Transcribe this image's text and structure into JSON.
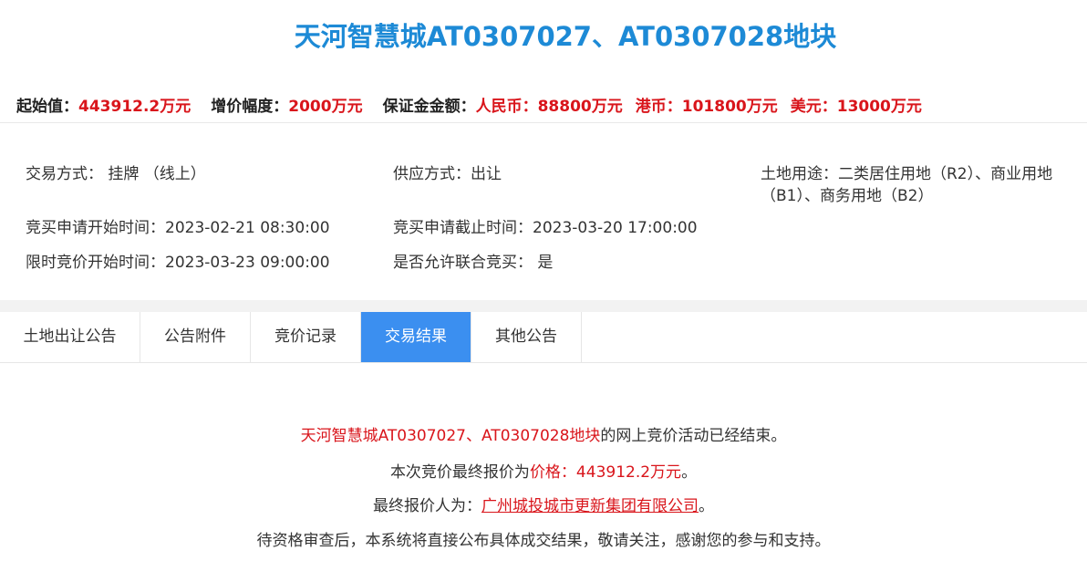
{
  "title": "天河智慧城AT0307027、AT0307028地块",
  "price_bar": {
    "start_label": "起始值：",
    "start_value": "443912.2万元",
    "inc_label": "增价幅度：",
    "inc_value": "2000万元",
    "deposit_label": "保证金金额：",
    "rmb_label": "人民币：",
    "rmb_value": "88800万元",
    "hkd_label": "港币：",
    "hkd_value": "101800万元",
    "usd_label": "美元：",
    "usd_value": "13000万元"
  },
  "info": {
    "trade_method": "交易方式：  挂牌 （线上）",
    "supply_method": "供应方式：出让",
    "land_use": "土地用途：二类居住用地（R2）、商业用地（B1）、商务用地（B2）",
    "apply_start": "竞买申请开始时间：2023-02-21 08:30:00",
    "apply_end": "竞买申请截止时间：2023-03-20 17:00:00",
    "bid_start": "限时竞价开始时间：2023-03-23 09:00:00",
    "joint_bid": "是否允许联合竞买：  是"
  },
  "tabs": [
    {
      "label": "土地出让公告"
    },
    {
      "label": "公告附件"
    },
    {
      "label": "竞价记录"
    },
    {
      "label": "交易结果"
    },
    {
      "label": "其他公告"
    }
  ],
  "result": {
    "line1_red": "天河智慧城AT0307027、AT0307028地块",
    "line1_rest": "的网上竞价活动已经结束。",
    "line2_prefix": "本次竞价最终报价为",
    "line2_red": "价格：443912.2万元",
    "line2_suffix": "。",
    "line3_prefix": "最终报价人为：",
    "line3_red": "广州城投城市更新集团有限公司",
    "line3_suffix": "。",
    "line4": "待资格审查后，本系统将直接公布具体成交结果，敬请关注，感谢您的参与和支持。"
  },
  "colors": {
    "title": "#1d8ad6",
    "highlight_red": "#d9151b",
    "active_tab": "#3b8ff0"
  }
}
